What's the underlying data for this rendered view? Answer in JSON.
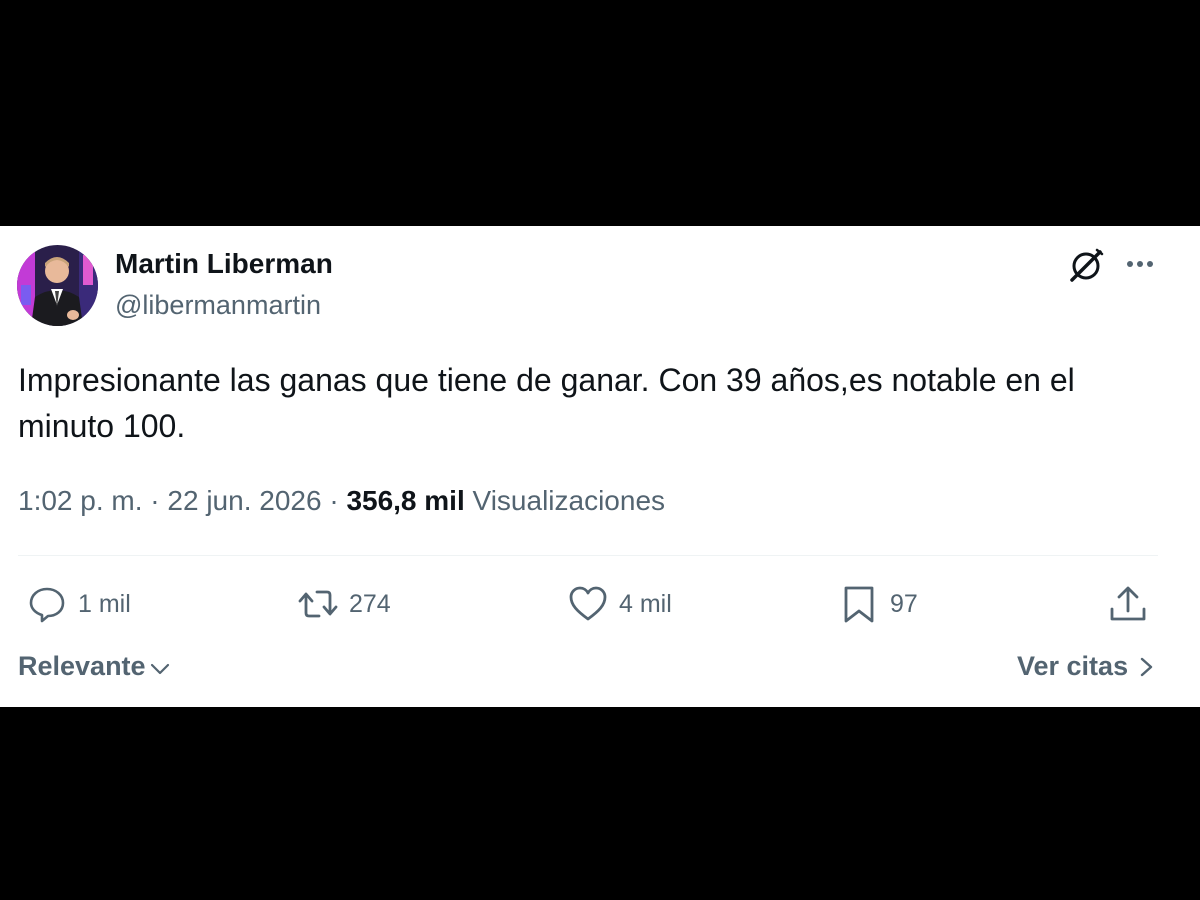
{
  "author": {
    "display_name": "Martin Liberman",
    "handle": "@libermanmartin",
    "avatar_icon": "person-photo-avatar"
  },
  "header_actions": {
    "grok_icon": "grok-icon",
    "more_icon": "more-dots-icon"
  },
  "tweet": {
    "text": "Impresionante las ganas que tiene de ganar. Con 39 años,es notable en el minuto 100."
  },
  "meta": {
    "time": "1:02 p. m.",
    "separator": "·",
    "date": "22 jun. 2026",
    "views_count": "356,8 mil",
    "views_label": "Visualizaciones"
  },
  "actions": {
    "replies": "1 mil",
    "retweets": "274",
    "likes": "4 mil",
    "bookmarks": "97"
  },
  "footer": {
    "sort_label": "Relevante",
    "quotes_label": "Ver citas"
  },
  "colors": {
    "background": "#000000",
    "card": "#ffffff",
    "primary_text": "#0f1419",
    "secondary_text": "#536471",
    "divider": "#eff3f4"
  }
}
